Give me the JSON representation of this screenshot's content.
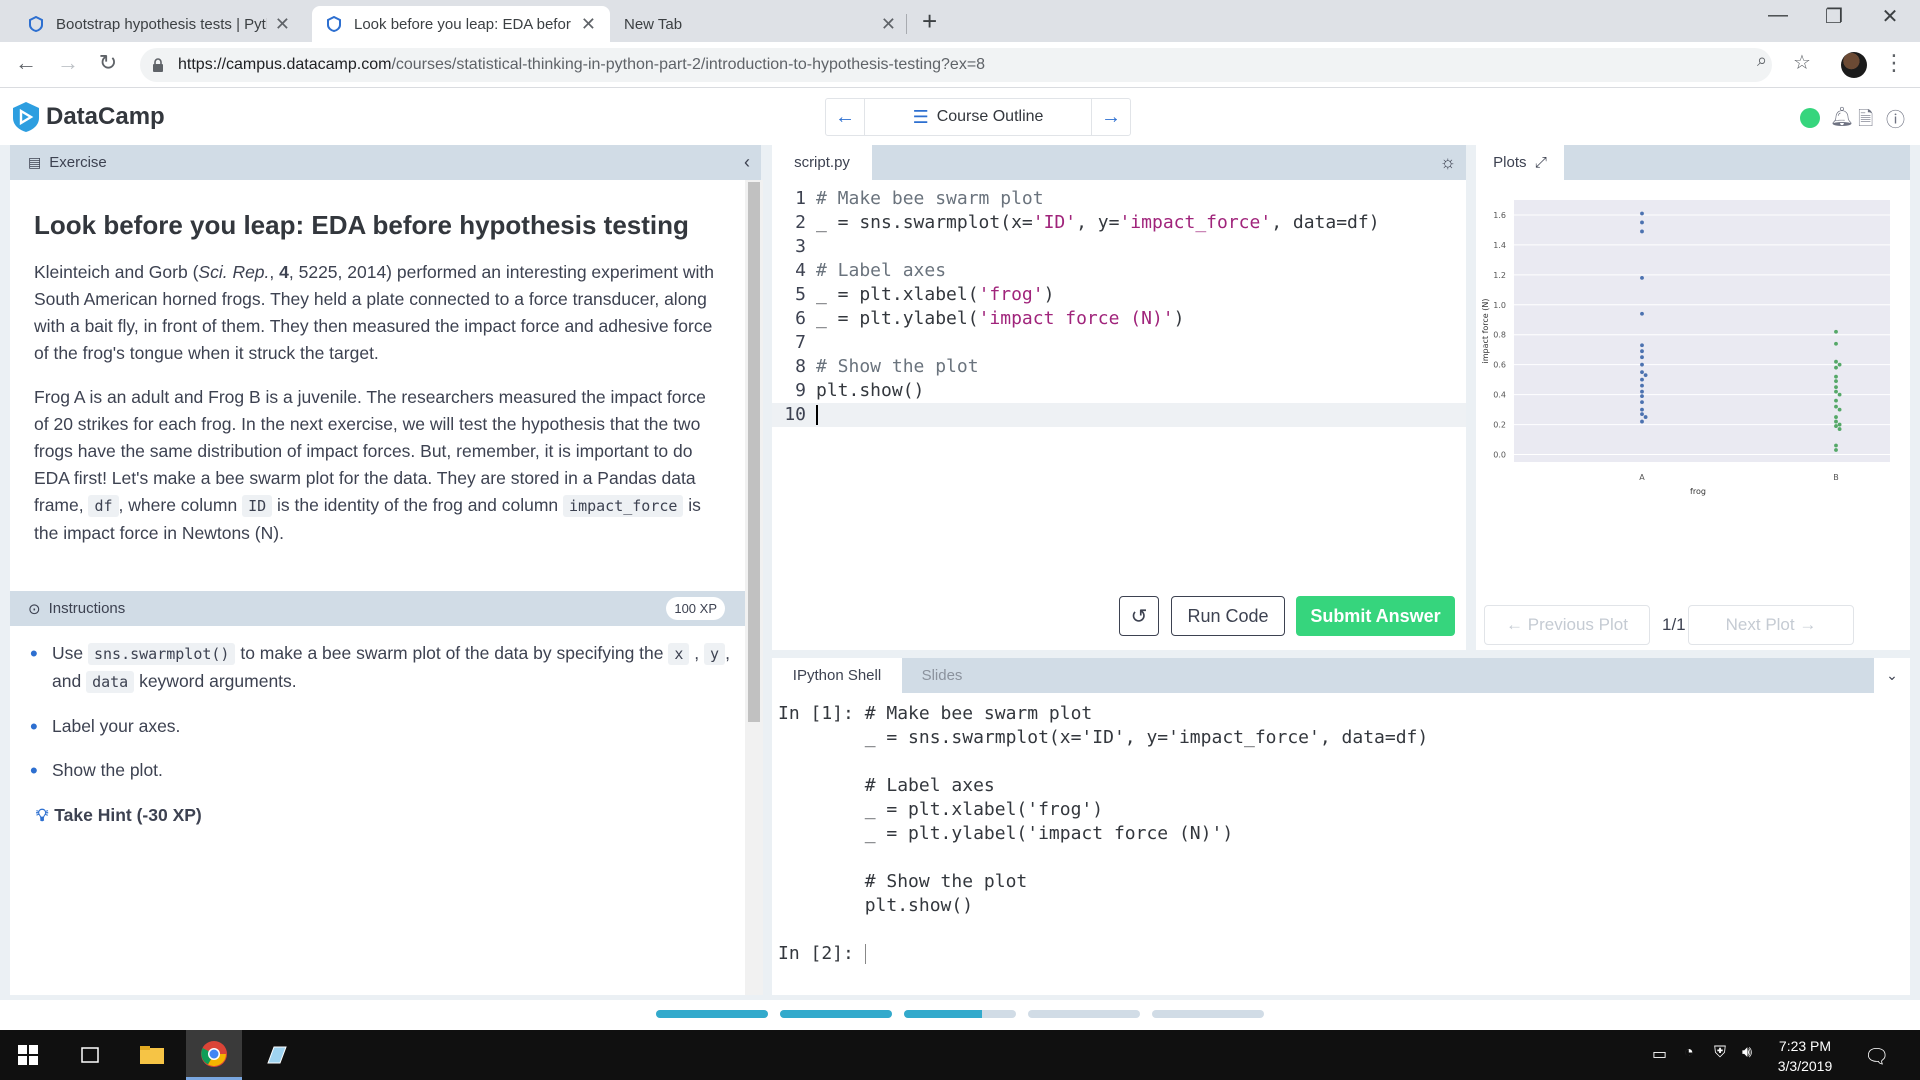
{
  "browser": {
    "tabs": [
      {
        "title": "Bootstrap hypothesis tests | Pyth",
        "active": false
      },
      {
        "title": "Look before you leap: EDA befor",
        "active": true
      },
      {
        "title": "New Tab",
        "active": false
      }
    ],
    "url_host": "https://campus.datacamp.com",
    "url_path": "/courses/statistical-thinking-in-python-part-2/introduction-to-hypothesis-testing?ex=8"
  },
  "header": {
    "logo_text": "DataCamp",
    "course_outline": "Course Outline",
    "status_color": "#36d57d"
  },
  "exercise": {
    "section_label": "Exercise",
    "title": "Look before you leap: EDA before hypothesis testing",
    "p1_a": "Kleinteich and Gorb (",
    "p1_ref": "Sci. Rep.",
    "p1_b": ", ",
    "p1_vol": "4",
    "p1_c": ", 5225, 2014) performed an interesting experiment with South American horned frogs. They held a plate connected to a force transducer, along with a bait fly, in front of them. They then measured the impact force and adhesive force of the frog's tongue when it struck the target.",
    "p2_a": "Frog A is an adult and Frog B is a juvenile. The researchers measured the impact force of 20 strikes for each frog. In the next exercise, we will test the hypothesis that the two frogs have the same distribution of impact forces. But, remember, it is important to do EDA first! Let's make a bee swarm plot for the data. They are stored in a Pandas data frame,",
    "p2_df": "df",
    "p2_b": ", where column",
    "p2_id": "ID",
    "p2_c": "is the identity of the frog and column",
    "p2_col": "impact_force",
    "p2_d": "is the impact force in Newtons (N)."
  },
  "instructions": {
    "label": "Instructions",
    "xp": "100 XP",
    "i1_a": "Use",
    "i1_code": "sns.swarmplot()",
    "i1_b": "to make a bee swarm plot of the data by specifying the",
    "i1_x": "x",
    "i1_c": ",",
    "i1_y": "y",
    "i1_d": ", and",
    "i1_data": "data",
    "i1_e": "keyword arguments.",
    "i2": "Label your axes.",
    "i3": "Show the plot.",
    "hint": "Take Hint (-30 XP)"
  },
  "editor": {
    "tab": "script.py",
    "lines": [
      "# Make bee swarm plot",
      "_ = sns.swarmplot(x='ID', y='impact_force', data=df)",
      "",
      "# Label axes",
      "_ = plt.xlabel('frog')",
      "_ = plt.ylabel('impact force (N)')",
      "",
      "# Show the plot",
      "plt.show()",
      ""
    ],
    "run_label": "Run Code",
    "submit_label": "Submit Answer",
    "submit_color": "#36d57d"
  },
  "plots": {
    "tab": "Plots",
    "prev": "← Previous Plot",
    "next": "Next Plot →",
    "counter": "1/1"
  },
  "chart_data": {
    "type": "scatter",
    "title": "",
    "xlabel": "frog",
    "ylabel": "impact force (N)",
    "categories": [
      "A",
      "B"
    ],
    "ylim": [
      -0.05,
      1.7
    ],
    "yticks": [
      0.0,
      0.2,
      0.4,
      0.6,
      0.8,
      1.0,
      1.2,
      1.4,
      1.6
    ],
    "grid": true,
    "series": [
      {
        "category": "A",
        "color": "#4c72b0",
        "values": [
          1.61,
          1.55,
          1.49,
          1.18,
          0.94,
          0.73,
          0.69,
          0.65,
          0.6,
          0.55,
          0.53,
          0.5,
          0.46,
          0.42,
          0.39,
          0.35,
          0.3,
          0.27,
          0.25,
          0.22
        ]
      },
      {
        "category": "B",
        "color": "#55a868",
        "values": [
          0.82,
          0.74,
          0.62,
          0.6,
          0.58,
          0.52,
          0.49,
          0.45,
          0.42,
          0.4,
          0.36,
          0.32,
          0.3,
          0.25,
          0.22,
          0.2,
          0.19,
          0.17,
          0.06,
          0.03
        ]
      }
    ]
  },
  "shell": {
    "tab_active": "IPython Shell",
    "tab_other": "Slides",
    "prompt1": "In [1]:",
    "prompt2": "In [2]:",
    "lines": [
      "# Make bee swarm plot",
      "_ = sns.swarmplot(x='ID', y='impact_force', data=df)",
      "",
      "# Label axes",
      "_ = plt.xlabel('frog')",
      "_ = plt.ylabel('impact force (N)')",
      "",
      "# Show the plot",
      "plt.show()"
    ]
  },
  "progress": [
    1.0,
    1.0,
    0.7,
    0.0,
    0.0
  ],
  "taskbar": {
    "time": "7:23 PM",
    "date": "3/3/2019"
  }
}
